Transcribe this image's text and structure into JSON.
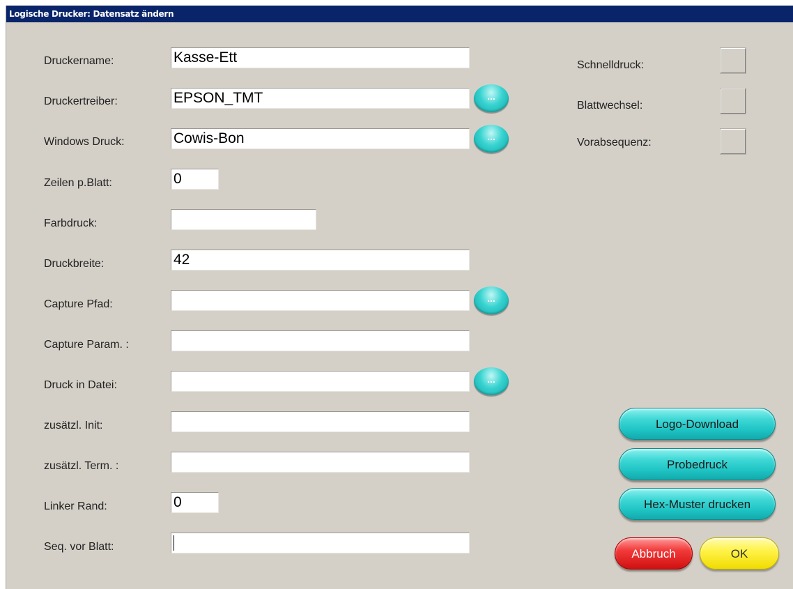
{
  "window": {
    "title": "Logische Drucker: Datensatz ändern"
  },
  "form": {
    "druckername": {
      "label": "Druckername:",
      "value": "Kasse-Ett"
    },
    "druckertreiber": {
      "label": "Druckertreiber:",
      "value": "EPSON_TMT"
    },
    "windows_druck": {
      "label": "Windows Druck:",
      "value": "Cowis-Bon"
    },
    "zeilen_p_blatt": {
      "label": "Zeilen p.Blatt:",
      "value": "0"
    },
    "farbdruck": {
      "label": "Farbdruck:",
      "value": ""
    },
    "druckbreite": {
      "label": "Druckbreite:",
      "value": "42"
    },
    "capture_pfad": {
      "label": "Capture Pfad:",
      "value": ""
    },
    "capture_param": {
      "label": "Capture Param. :",
      "value": ""
    },
    "druck_in_datei": {
      "label": "Druck in Datei:",
      "value": ""
    },
    "zusaetzl_init": {
      "label": "zusätzl. Init:",
      "value": ""
    },
    "zusaetzl_term": {
      "label": "zusätzl. Term. :",
      "value": ""
    },
    "linker_rand": {
      "label": "Linker Rand:",
      "value": "0"
    },
    "seq_vor_blatt": {
      "label": "Seq. vor Blatt:",
      "value": ""
    }
  },
  "browse_button_label": "...",
  "options": {
    "schnelldruck": {
      "label": "Schnelldruck:",
      "checked": false
    },
    "blattwechsel": {
      "label": "Blattwechsel:",
      "checked": false
    },
    "vorabsequenz": {
      "label": "Vorabsequenz:",
      "checked": false
    }
  },
  "actions": {
    "logo_download": "Logo-Download",
    "probedruck": "Probedruck",
    "hex_muster": "Hex-Muster drucken",
    "abbruch": "Abbruch",
    "ok": "OK"
  }
}
